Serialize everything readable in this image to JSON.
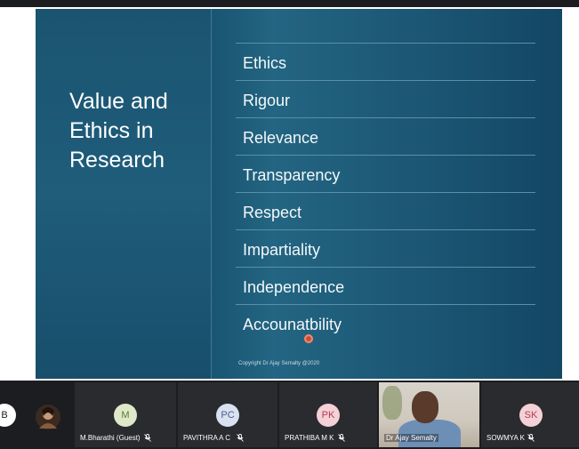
{
  "slide": {
    "title_lines": [
      "Value and",
      "Ethics in",
      "Research"
    ],
    "items": [
      "Ethics",
      "Rigour",
      "Relevance",
      "Transparency",
      "Respect",
      "Impartiality",
      "Independence",
      "Accounatbility"
    ],
    "copyright": "Copyright Dr Ajay Semalty @2020"
  },
  "participants": {
    "tiles": [
      {
        "initials": "B",
        "name": "",
        "color": "#ffffff",
        "text_color": "#1c1d20"
      },
      {
        "initials": "",
        "name": "",
        "color": "#2a2b2f"
      },
      {
        "initials": "M",
        "name": "M.Bharathi (Guest)",
        "color": "#dfe9c8",
        "text_color": "#5c7a3a"
      },
      {
        "initials": "PC",
        "name": "PAVITHRA A C",
        "color": "#d9e2f1",
        "text_color": "#4a5f86"
      },
      {
        "initials": "PK",
        "name": "PRATHIBA M K",
        "color": "#f4d1d6",
        "text_color": "#b33b52"
      },
      {
        "initials": "SK",
        "name": "SOWMYA K",
        "color": "#f4d1d6",
        "text_color": "#b33b52"
      }
    ],
    "video_name": "Dr Ajay Semalty"
  },
  "colors": {
    "slide_bg": "#1a5774",
    "toolbar_bg": "#1c1d20"
  }
}
